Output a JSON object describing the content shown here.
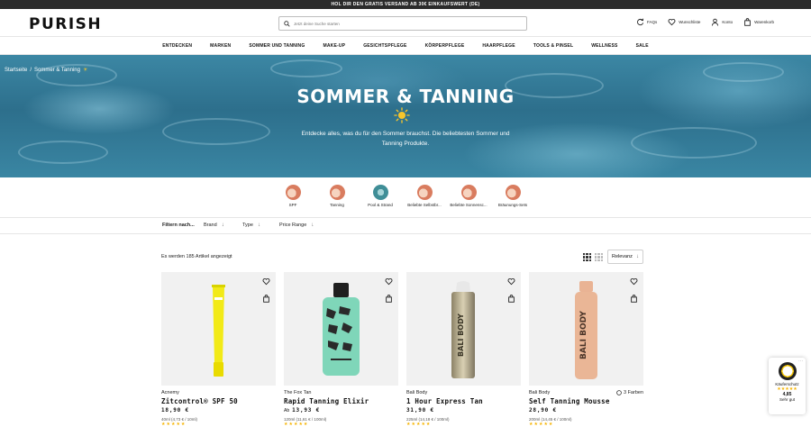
{
  "topbar": {
    "text": "HOL DIR DEN GRATIS VERSAND AB 30€ EINKAUFSWERT (DE)"
  },
  "header": {
    "logo": "PURISH",
    "search_placeholder": "Jetzt deine Suche starten",
    "links": [
      {
        "label": "FAQs",
        "icon": "refresh-icon"
      },
      {
        "label": "Wunschliste",
        "icon": "heart-icon"
      },
      {
        "label": "Konto",
        "icon": "user-icon"
      },
      {
        "label": "Warenkorb",
        "icon": "bag-icon"
      }
    ]
  },
  "nav": [
    "ENTDECKEN",
    "MARKEN",
    "SOMMER UND TANNING",
    "MAKE-UP",
    "GESICHTSPFLEGE",
    "KÖRPERPFLEGE",
    "HAARPFLEGE",
    "TOOLS & PINSEL",
    "WELLNESS",
    "SALE"
  ],
  "breadcrumb": {
    "home": "Startseite",
    "sep": "/",
    "current": "Sommer & Tanning",
    "emoji": "☀"
  },
  "hero": {
    "title": "SOMMER & TANNING",
    "text": "Entdecke alles, was du für den Sommer brauchst. Die beliebtesten Sommer und Tanning Produkte."
  },
  "categories": [
    "SPF",
    "Tanning",
    "Pool & Strand",
    "Beliebte Selbstbr...",
    "Beliebte Sonnensc...",
    "Bräunungs-Sets"
  ],
  "filters": {
    "label": "Filtern nach...",
    "items": [
      "Brand",
      "Type",
      "Price Range"
    ]
  },
  "results": {
    "count_text": "Es werden 185 Artikel angezeigt",
    "sort_label": "Relevanz"
  },
  "products": [
    {
      "brand": "Acnemy",
      "name": "Zitcontrol® SPF 50",
      "price_prefix": "",
      "price": "18,90 €",
      "unit": "40ml (4,73 € / 10ml)",
      "colors": ""
    },
    {
      "brand": "The Fox Tan",
      "name": "Rapid Tanning Elixir",
      "price_prefix": "Ab",
      "price": "13,93 €",
      "unit": "120ml (11,61 € / 100ml)",
      "colors": ""
    },
    {
      "brand": "Bali Body",
      "name": "1 Hour Express Tan",
      "price_prefix": "",
      "price": "31,90 €",
      "unit": "225ml (14,18 € / 100ml)",
      "colors": ""
    },
    {
      "brand": "Bali Body",
      "name": "Self Tanning Mousse",
      "price_prefix": "",
      "price": "28,90 €",
      "unit": "200ml (14,45 € / 100ml)",
      "colors": "3 Farben"
    }
  ],
  "trust_badge": {
    "label": "Käuferschutz",
    "rating": "4,85",
    "rating_text": "Sehr gut",
    "stars": "★★★★★"
  },
  "colors": {
    "topbar": "#2b2b2b",
    "accent_star": "#f5b301",
    "hero_water": "#2d6f8c"
  }
}
